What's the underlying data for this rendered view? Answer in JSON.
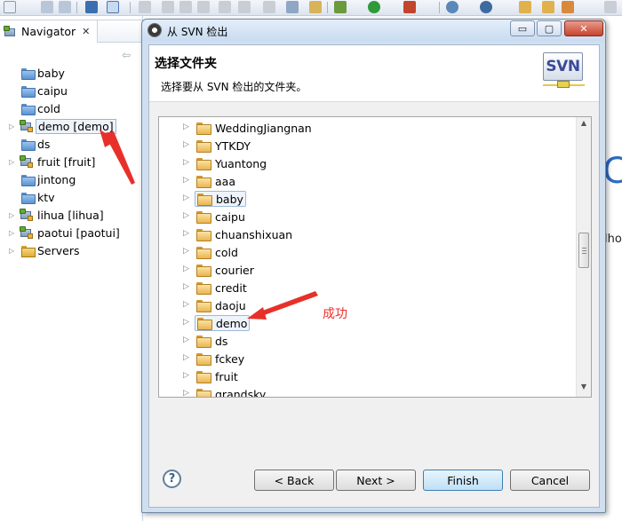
{
  "navigator": {
    "title": "Navigator",
    "close_glyph": "✕",
    "back_glyph": "⇦",
    "items": [
      {
        "label": "baby",
        "type": "folder",
        "twisty": ""
      },
      {
        "label": "caipu",
        "type": "folder",
        "twisty": ""
      },
      {
        "label": "cold",
        "type": "folder",
        "twisty": ""
      },
      {
        "label": "demo [demo]",
        "type": "project",
        "twisty": "▷",
        "selected": true
      },
      {
        "label": "ds",
        "type": "folder",
        "twisty": ""
      },
      {
        "label": "fruit [fruit]",
        "type": "project",
        "twisty": "▷"
      },
      {
        "label": "jintong",
        "type": "folder",
        "twisty": ""
      },
      {
        "label": "ktv",
        "type": "folder",
        "twisty": ""
      },
      {
        "label": "lihua [lihua]",
        "type": "project",
        "twisty": "▷"
      },
      {
        "label": "paotui [paotui]",
        "type": "project",
        "twisty": "▷"
      },
      {
        "label": "Servers",
        "type": "servers",
        "twisty": "▷"
      }
    ]
  },
  "background": {
    "right_glyph_1": "C",
    "right_glyph_2": "lho"
  },
  "dialog": {
    "window_title": "从 SVN 检出",
    "header_title": "选择文件夹",
    "header_description": "选择要从 SVN 检出的文件夹。",
    "logo_text": "SVN",
    "window_buttons": {
      "minimize": "▭",
      "maximize": "▢",
      "close": "✕"
    },
    "folders": [
      {
        "label": "WeddingJiangnan"
      },
      {
        "label": "YTKDY"
      },
      {
        "label": "Yuantong"
      },
      {
        "label": "aaa"
      },
      {
        "label": "baby",
        "highlighted": true
      },
      {
        "label": "caipu"
      },
      {
        "label": "chuanshixuan"
      },
      {
        "label": "cold"
      },
      {
        "label": "courier"
      },
      {
        "label": "credit"
      },
      {
        "label": "daoju"
      },
      {
        "label": "demo",
        "highlighted": true
      },
      {
        "label": "ds"
      },
      {
        "label": "fckey"
      },
      {
        "label": "fruit"
      },
      {
        "label": "grandsky"
      }
    ],
    "scrollbar": {
      "position_fraction": 0.47
    },
    "annotation_label": "成功",
    "help_glyph": "?",
    "buttons": {
      "back": "< Back",
      "next": "Next >",
      "finish": "Finish",
      "cancel": "Cancel"
    }
  }
}
